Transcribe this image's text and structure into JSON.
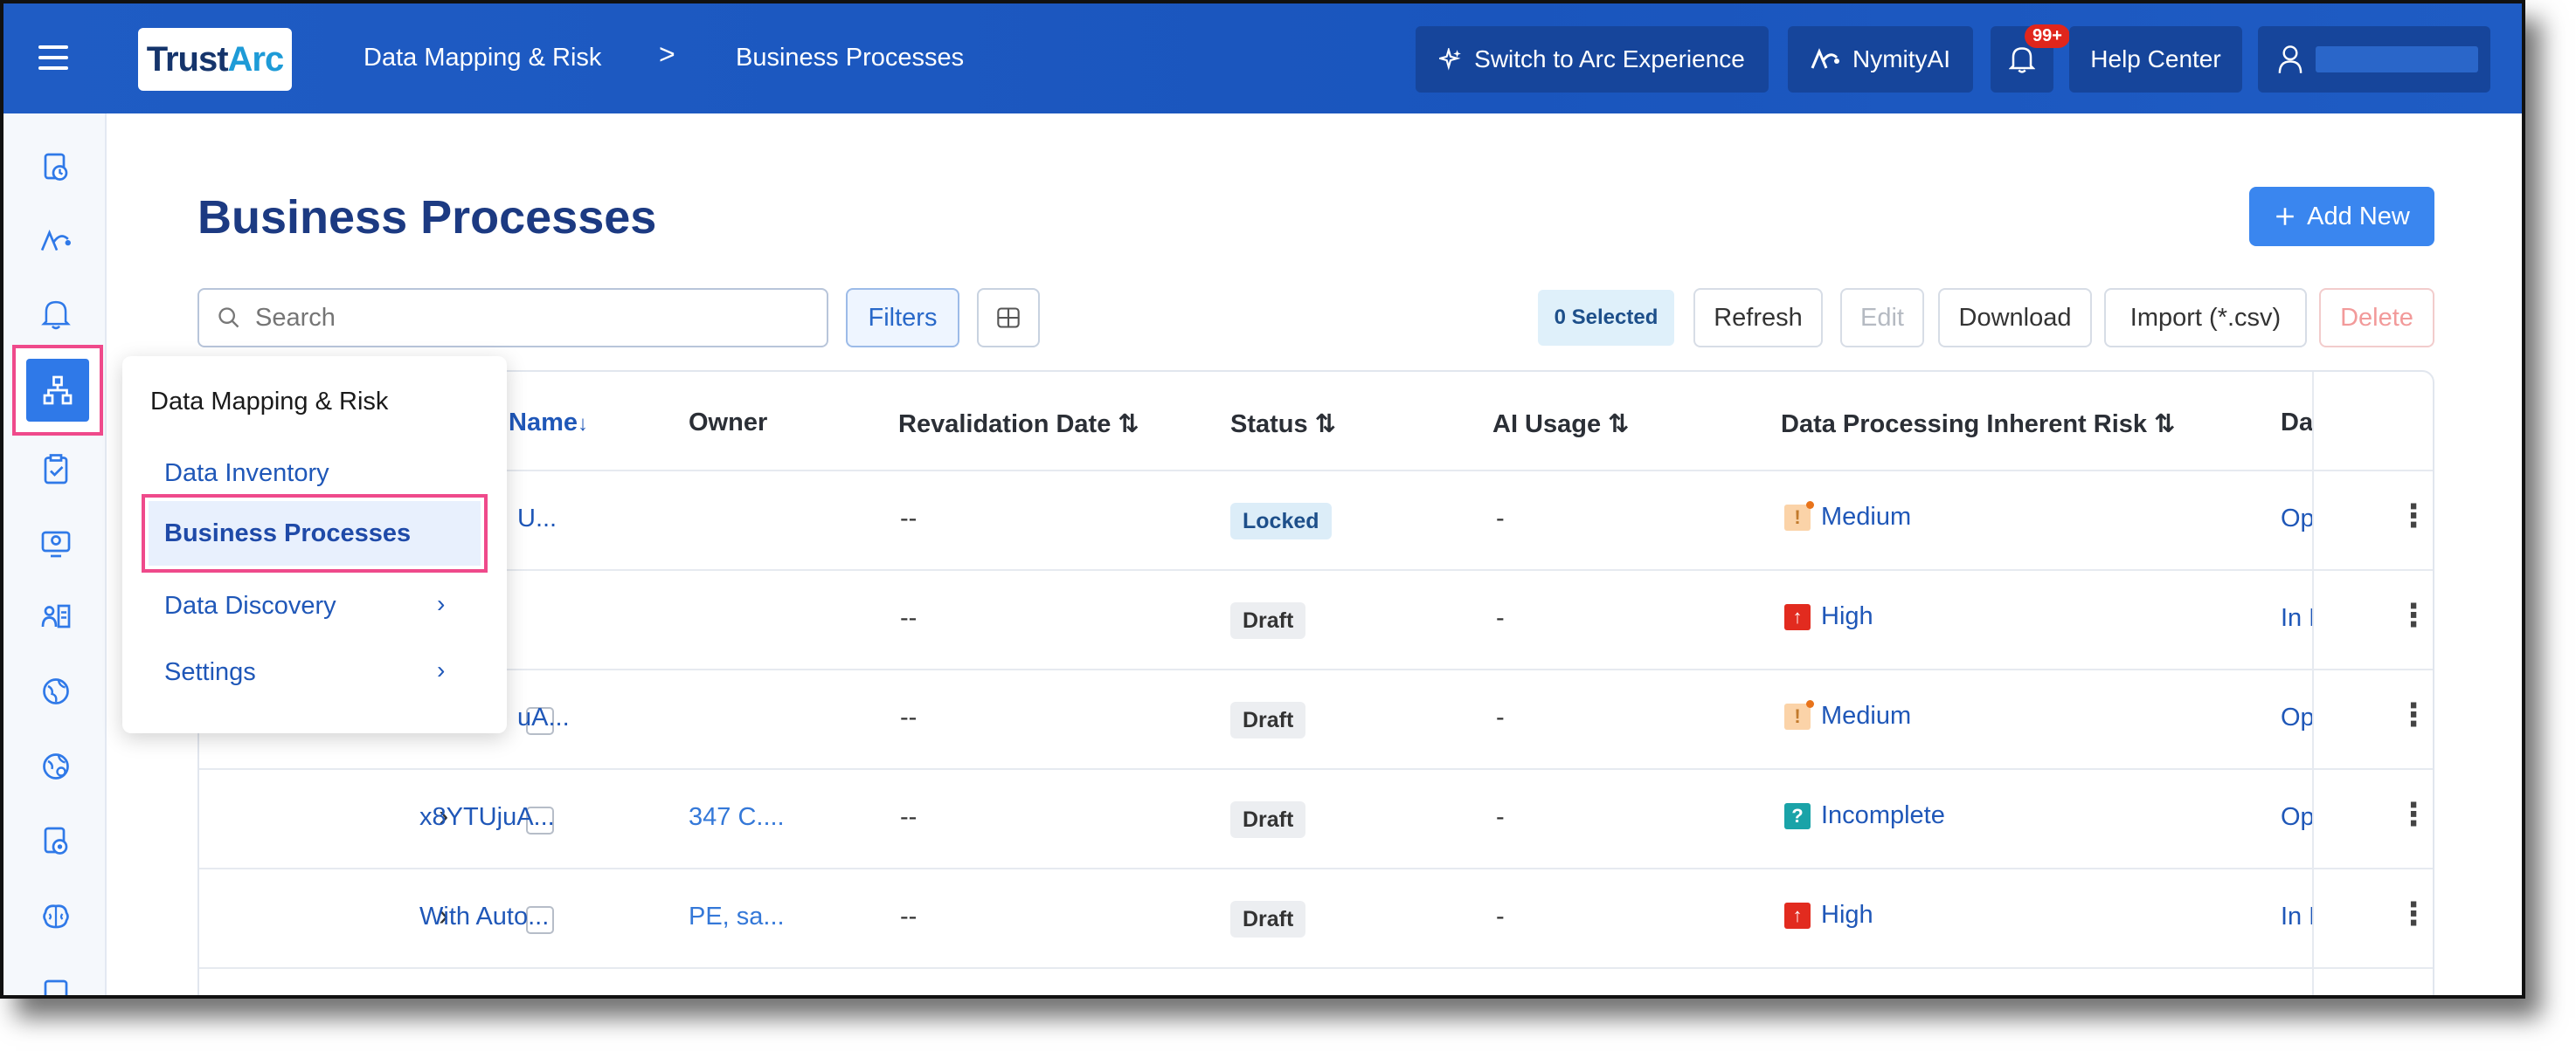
{
  "topbar": {
    "logo_text": "TrustArc",
    "logo_main": "Trust",
    "logo_accent": "Arc",
    "breadcrumb": [
      "Data Mapping & Risk",
      "Business Processes"
    ],
    "breadcrumb_sep": ">",
    "switch_label": "Switch to Arc Experience",
    "nymity_label": "NymityAI",
    "notification_count": "99+",
    "help_label": "Help Center",
    "brand_color": "#1f5cc4"
  },
  "page": {
    "title": "Business Processes",
    "add_new_label": "Add New"
  },
  "toolbar": {
    "search_placeholder": "Search",
    "filters_label": "Filters",
    "selected_label": "0 Selected",
    "refresh_label": "Refresh",
    "edit_label": "Edit",
    "download_label": "Download",
    "import_label": "Import (*.csv)",
    "delete_label": "Delete"
  },
  "table": {
    "columns": {
      "name": "Name",
      "owner": "Owner",
      "revalidation": "Revalidation Date",
      "status": "Status",
      "ai_usage": "AI Usage",
      "risk": "Data Processing Inherent Risk",
      "data": "Data"
    },
    "rows": [
      {
        "name": "U...",
        "owner": "",
        "revalidation": "--",
        "status": "Locked",
        "ai_usage": "-",
        "risk": "Medium",
        "data": "Ope"
      },
      {
        "name": "",
        "owner": "",
        "revalidation": "--",
        "status": "Draft",
        "ai_usage": "-",
        "risk": "High",
        "data": "In Pr"
      },
      {
        "name": "uA...",
        "owner": "",
        "revalidation": "--",
        "status": "Draft",
        "ai_usage": "-",
        "risk": "Medium",
        "data": "Ope"
      },
      {
        "name": "x8YTUjuA...",
        "owner": "347 C....",
        "revalidation": "--",
        "status": "Draft",
        "ai_usage": "-",
        "risk": "Incomplete",
        "data": "Ope"
      },
      {
        "name": "With Auto...",
        "owner": "PE, sa...",
        "revalidation": "--",
        "status": "Draft",
        "ai_usage": "-",
        "risk": "High",
        "data": "In Re"
      }
    ]
  },
  "flyout": {
    "title": "Data Mapping & Risk",
    "items": [
      "Data Inventory",
      "Business Processes",
      "Data Discovery",
      "Settings"
    ]
  }
}
